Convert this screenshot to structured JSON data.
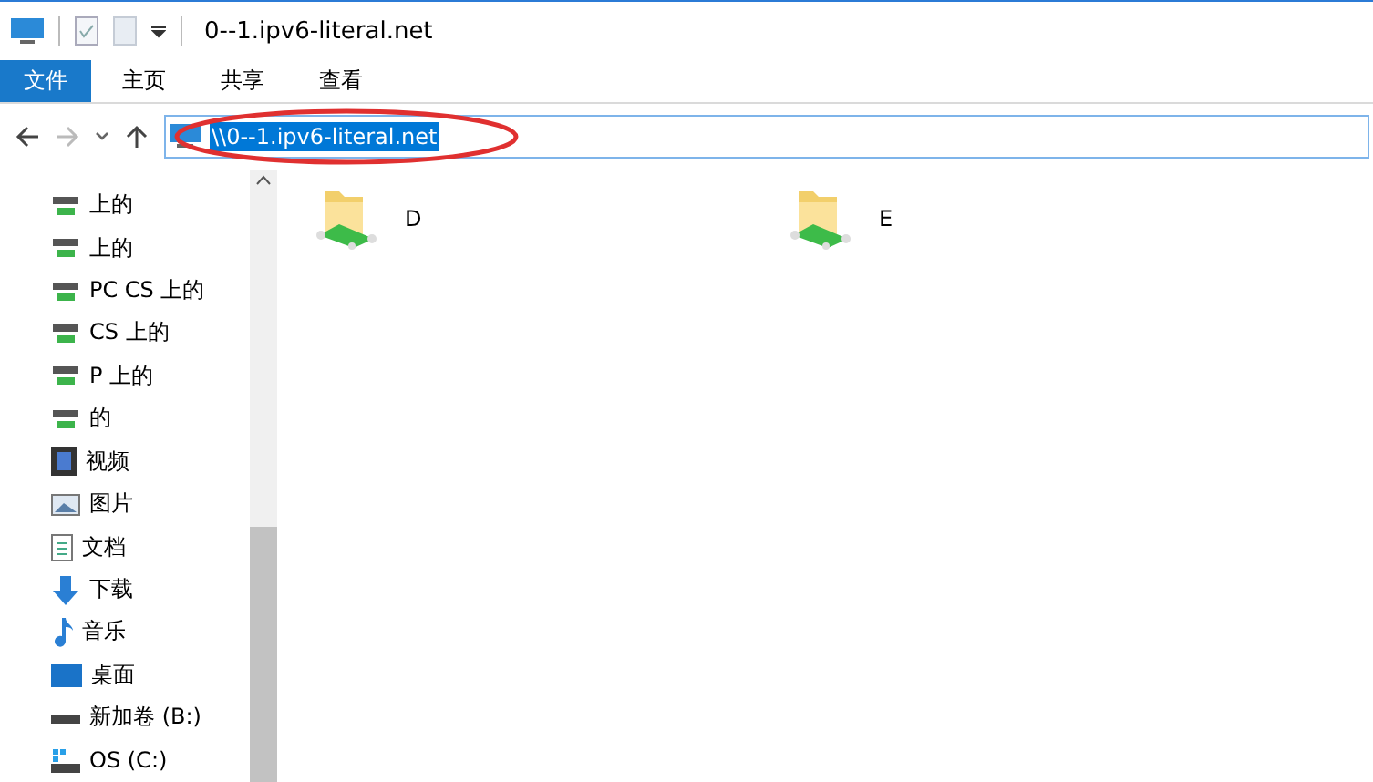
{
  "window": {
    "title": "0--1.ipv6-literal.net"
  },
  "ribbon_tabs": [
    {
      "label": "文件",
      "selected": true
    },
    {
      "label": "主页",
      "selected": false
    },
    {
      "label": "共享",
      "selected": false
    },
    {
      "label": "查看",
      "selected": false
    }
  ],
  "address_bar": {
    "path": "\\\\0--1.ipv6-literal.net",
    "selected": true
  },
  "sidebar": {
    "items": [
      {
        "label": "上的",
        "kind": "share"
      },
      {
        "label": "上的",
        "kind": "share"
      },
      {
        "label": "PC CS 上的",
        "kind": "share"
      },
      {
        "label": "CS 上的",
        "kind": "share"
      },
      {
        "label": "P 上的",
        "kind": "share"
      },
      {
        "label": "的",
        "kind": "share"
      },
      {
        "label": "视频",
        "kind": "videos"
      },
      {
        "label": "图片",
        "kind": "pictures"
      },
      {
        "label": "文档",
        "kind": "documents"
      },
      {
        "label": "下载",
        "kind": "downloads"
      },
      {
        "label": "音乐",
        "kind": "music"
      },
      {
        "label": "桌面",
        "kind": "desktop"
      },
      {
        "label": "新加卷 (B:)",
        "kind": "drive"
      },
      {
        "label": "OS (C:)",
        "kind": "osdrive"
      }
    ]
  },
  "folders": [
    {
      "name": "D"
    },
    {
      "name": "E"
    }
  ]
}
